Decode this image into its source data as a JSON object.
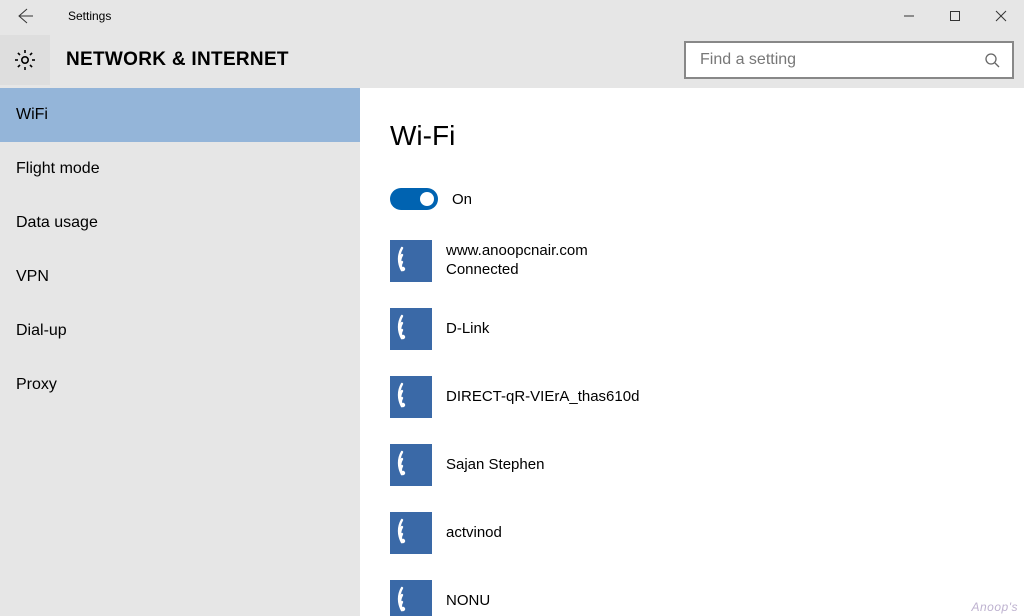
{
  "window": {
    "title": "Settings"
  },
  "header": {
    "category": "NETWORK & INTERNET"
  },
  "search": {
    "placeholder": "Find a setting"
  },
  "sidebar": {
    "items": [
      {
        "label": "WiFi",
        "selected": true
      },
      {
        "label": "Flight mode",
        "selected": false
      },
      {
        "label": "Data usage",
        "selected": false
      },
      {
        "label": "VPN",
        "selected": false
      },
      {
        "label": "Dial-up",
        "selected": false
      },
      {
        "label": "Proxy",
        "selected": false
      }
    ]
  },
  "content": {
    "heading": "Wi-Fi",
    "toggle": {
      "state": "On",
      "enabled": true
    }
  },
  "networks": [
    {
      "ssid": "www.anoopcnair.com",
      "status": "Connected"
    },
    {
      "ssid": "D-Link",
      "status": ""
    },
    {
      "ssid": "DIRECT-qR-VIErA_thas610d",
      "status": ""
    },
    {
      "ssid": "Sajan Stephen",
      "status": ""
    },
    {
      "ssid": "actvinod",
      "status": ""
    },
    {
      "ssid": "NONU",
      "status": ""
    }
  ],
  "watermark": "Anoop's"
}
